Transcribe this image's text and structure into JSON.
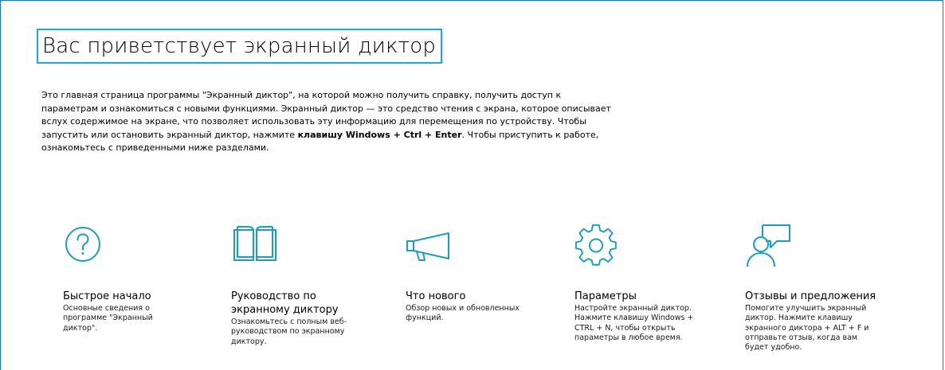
{
  "page": {
    "title": "Вас приветствует экранный диктор",
    "intro_part1": "Это главная страница программы \"Экранный диктор\", на которой можно получить справку, получить доступ к параметрам и ознакомиться с новыми функциями. Экранный диктор — это средство чтения с экрана, которое описывает вслух содержимое на экране, что позволяет использовать эту информацию для перемещения по устройству. Чтобы запустить или остановить экранный диктор, нажмите ",
    "intro_hotkey": "клавишу Windows + Ctrl + Enter",
    "intro_part2": ". Чтобы приступить к работе, ознакомьтесь с приведенными ниже разделами."
  },
  "accent_color": "#1a9ebd",
  "tiles": [
    {
      "icon": "help-circle-icon",
      "title": "Быстрое начало",
      "description": "Основные сведения о программе \"Экранный диктор\"."
    },
    {
      "icon": "book-icon",
      "title": "Руководство по экранному диктору",
      "description": "Ознакомьтесь с полным веб-руководством по экранному диктору."
    },
    {
      "icon": "megaphone-icon",
      "title": "Что нового",
      "description": "Обзор новых и обновленных функций."
    },
    {
      "icon": "gear-icon",
      "title": "Параметры",
      "description": "Настройте экранный диктор. Нажмите клавишу Windows + CTRL + N, чтобы открыть параметры в любое время."
    },
    {
      "icon": "feedback-person-icon",
      "title": "Отзывы и предложения",
      "description": "Помогите улучшить экранный диктор. Нажмите клавишу экранного диктора + ALT + F и отправьте отзыв, когда вам будет удобно."
    }
  ]
}
